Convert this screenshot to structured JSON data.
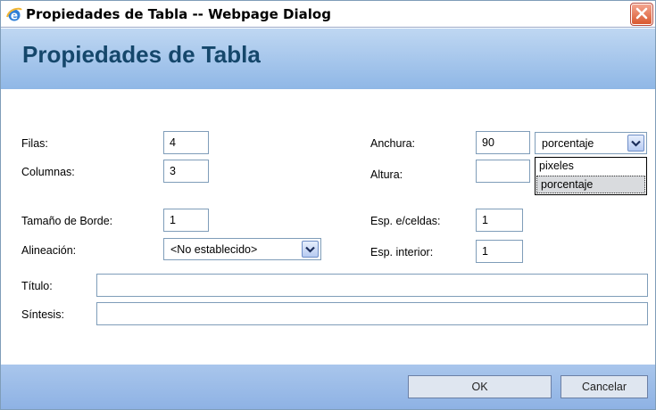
{
  "window": {
    "title": "Propiedades de Tabla -- Webpage Dialog",
    "icon": "ie-icon",
    "close_icon": "close-icon"
  },
  "header": {
    "heading": "Propiedades de Tabla"
  },
  "form": {
    "rows_label": "Filas:",
    "rows_value": "4",
    "cols_label": "Columnas:",
    "cols_value": "3",
    "width_label": "Anchura:",
    "width_value": "90",
    "width_unit_selected": "porcentaje",
    "width_unit_options": [
      "pixeles",
      "porcentaje"
    ],
    "height_label": "Altura:",
    "height_value": "",
    "border_label": "Tamaño de Borde:",
    "border_value": "1",
    "spacing_label": "Esp. e/celdas:",
    "spacing_value": "1",
    "align_label": "Alineación:",
    "align_selected": "<No establecido>",
    "padding_label": "Esp. interior:",
    "padding_value": "1",
    "title_label": "Título:",
    "title_value": "",
    "summary_label": "Síntesis:",
    "summary_value": ""
  },
  "footer": {
    "ok_label": "OK",
    "cancel_label": "Cancelar"
  },
  "colors": {
    "header_gradient_top": "#bfd7f2",
    "header_gradient_bottom": "#8fb7e6",
    "heading_text": "#15476b",
    "footer_bg": "#9ebde8",
    "close_button": "#d9582f"
  }
}
